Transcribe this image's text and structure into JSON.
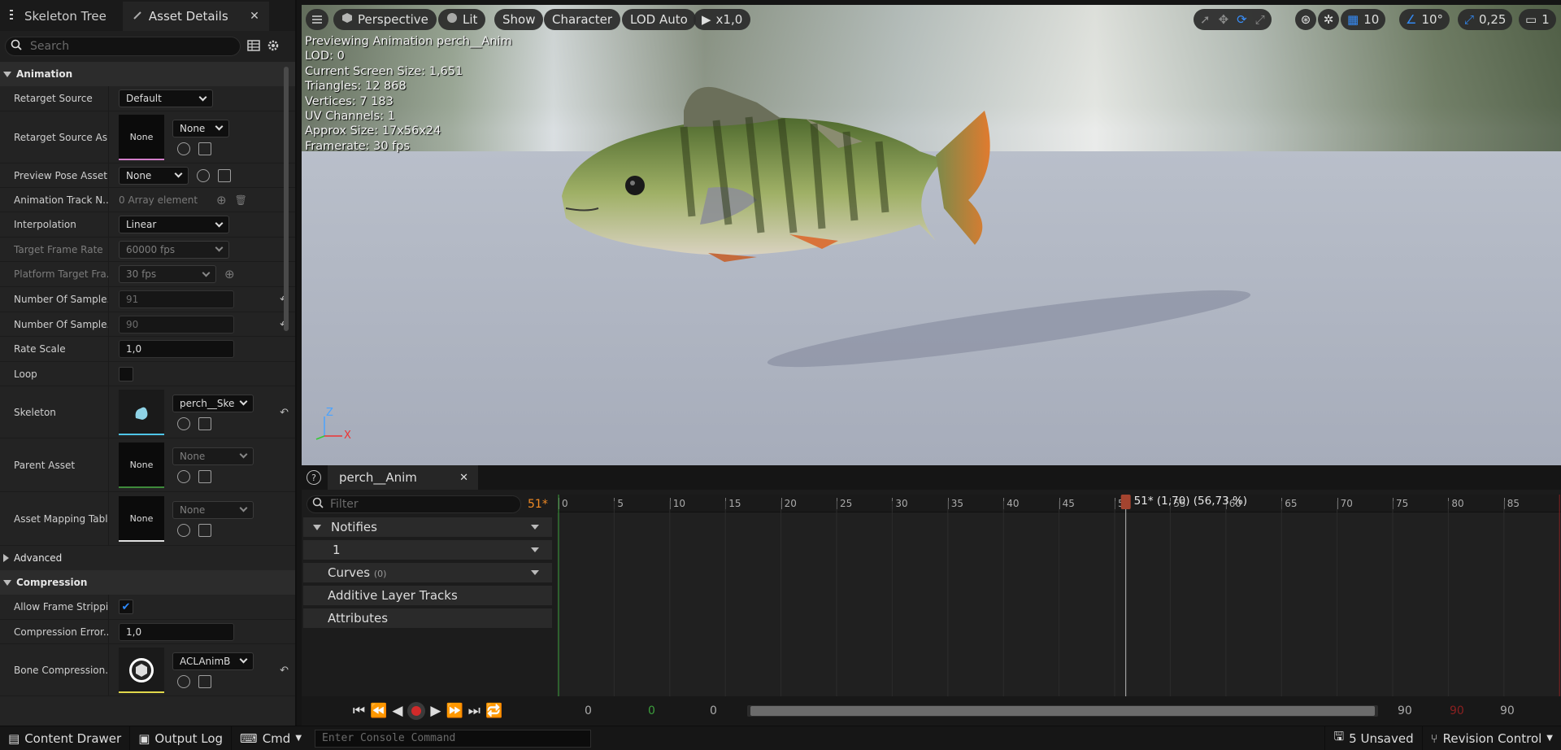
{
  "left_panel": {
    "tabs": {
      "skeleton_tree": "Skeleton Tree",
      "asset_details": "Asset Details"
    },
    "search_placeholder": "Search",
    "categories": {
      "animation": "Animation",
      "advanced": "Advanced",
      "compression": "Compression"
    },
    "rows": {
      "retarget_source": {
        "label": "Retarget Source",
        "value": "Default"
      },
      "retarget_source_asset": {
        "label": "Retarget Source As...",
        "thumb": "None",
        "value": "None"
      },
      "preview_pose_asset": {
        "label": "Preview Pose Asset",
        "value": "None"
      },
      "animation_track": {
        "label": "Animation Track N...",
        "value": "0 Array element"
      },
      "interpolation": {
        "label": "Interpolation",
        "value": "Linear"
      },
      "target_frame_rate": {
        "label": "Target Frame Rate",
        "value": "60000 fps"
      },
      "platform_target": {
        "label": "Platform Target Fra...",
        "value": "30 fps"
      },
      "num_samples_1": {
        "label": "Number Of Sample...",
        "value": "91"
      },
      "num_samples_2": {
        "label": "Number Of Sample...",
        "value": "90"
      },
      "rate_scale": {
        "label": "Rate Scale",
        "value": "1,0"
      },
      "loop": {
        "label": "Loop"
      },
      "skeleton": {
        "label": "Skeleton",
        "value": "perch__Ske"
      },
      "parent_asset": {
        "label": "Parent Asset",
        "thumb": "None",
        "value": "None"
      },
      "asset_mapping": {
        "label": "Asset Mapping Table",
        "thumb": "None",
        "value": "None"
      },
      "allow_frame_stripping": {
        "label": "Allow Frame Strippi..."
      },
      "compression_error": {
        "label": "Compression Error...",
        "value": "1,0"
      },
      "bone_compression": {
        "label": "Bone Compression...",
        "value": "ACLAnimB"
      }
    }
  },
  "viewport": {
    "toolbar": {
      "perspective": "Perspective",
      "lit": "Lit",
      "show": "Show",
      "character": "Character",
      "lod": "LOD Auto",
      "speed": "x1,0",
      "grid": "10",
      "angle": "10°",
      "scale": "0,25",
      "camera": "1"
    },
    "stats": [
      "Previewing Animation perch__Anim",
      "LOD: 0",
      "Current Screen Size: 1,651",
      "Triangles: 12 868",
      "Vertices: 7 183",
      "UV Channels: 1",
      "Approx Size: 17x56x24",
      "Framerate: 30 fps"
    ],
    "axis": {
      "z": "Z",
      "x": "X"
    }
  },
  "sequencer": {
    "tab": "perch__Anim",
    "filter_placeholder": "Filter",
    "frame_badge": "51*",
    "tracks": {
      "notifies": "Notifies",
      "notify_1": "1",
      "curves": "Curves",
      "curves_count": "(0)",
      "additive": "Additive Layer Tracks",
      "attributes": "Attributes"
    },
    "ruler_labels": [
      "0",
      "5",
      "10",
      "15",
      "20",
      "25",
      "30",
      "35",
      "40",
      "45",
      "50",
      "55",
      "60",
      "65",
      "70",
      "75",
      "80",
      "85"
    ],
    "playhead_label": "51* (1,70) (56,73 %)",
    "playhead_frame": 51,
    "total_frames": 90,
    "transport": {
      "start": "0",
      "green": "0",
      "left": "0",
      "end": "90",
      "red": "90",
      "right": "90"
    }
  },
  "bottom_bar": {
    "content_drawer": "Content Drawer",
    "output_log": "Output Log",
    "cmd": "Cmd",
    "console_placeholder": "Enter Console Command",
    "unsaved": "5 Unsaved",
    "revision_control": "Revision Control"
  }
}
